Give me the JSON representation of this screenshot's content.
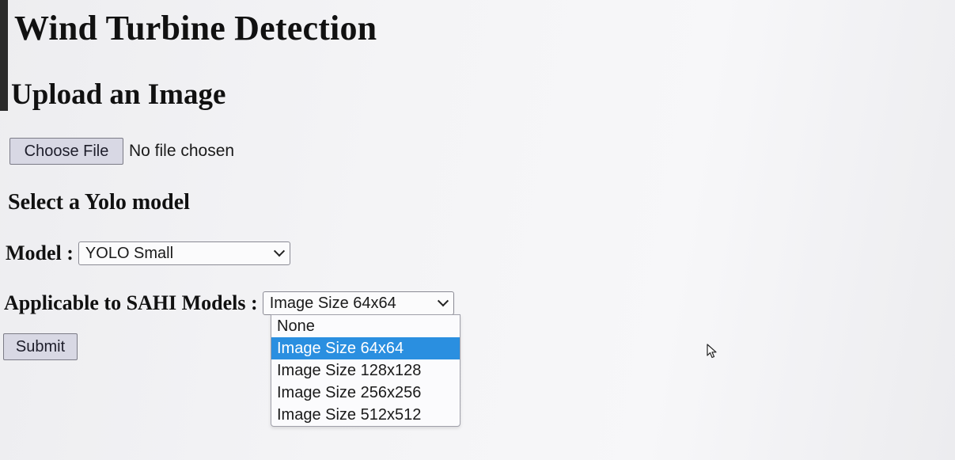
{
  "page": {
    "title": "Wind Turbine Detection",
    "upload_heading": "Upload an Image",
    "model_heading": "Select a Yolo model"
  },
  "file_input": {
    "button_label": "Choose File",
    "status": "No file chosen"
  },
  "model_select": {
    "label": "Model :",
    "selected": "YOLO Small"
  },
  "sahi_select": {
    "label": "Applicable to SAHI Models :",
    "selected": "Image Size 64x64",
    "open": true,
    "options": [
      "None",
      "Image Size 64x64",
      "Image Size 128x128",
      "Image Size 256x256",
      "Image Size 512x512"
    ],
    "highlighted_option": "Image Size 64x64"
  },
  "form": {
    "submit_label": "Submit"
  },
  "colors": {
    "highlight": "#2a8fe0",
    "button_bg": "#d8d8e4"
  }
}
